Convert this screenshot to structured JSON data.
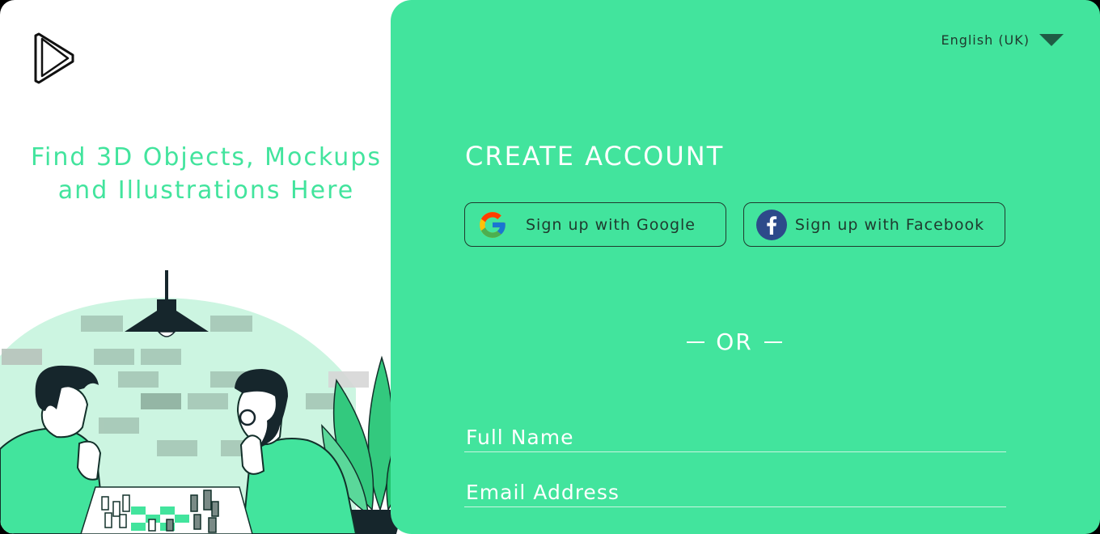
{
  "brand": {
    "logo_icon": "play-triangle-logo-icon"
  },
  "left": {
    "tagline_line1": "Find 3D Objects, Mockups",
    "tagline_line2": "and Illustrations Here",
    "illustration": "two-men-playing-chess-illustration"
  },
  "right": {
    "language": {
      "label": "English (UK)",
      "icon": "chevron-down-icon"
    },
    "title": "CREATE ACCOUNT",
    "social": {
      "google_label": "Sign up with Google",
      "google_icon": "google-icon",
      "facebook_label": "Sign up with Facebook",
      "facebook_icon": "facebook-icon"
    },
    "divider": "OR",
    "form": {
      "fullname_placeholder": "Full Name",
      "email_placeholder": "Email Address"
    }
  },
  "colors": {
    "accent": "#42e49d",
    "dark_text": "#1f3a2e",
    "white": "#ffffff"
  }
}
